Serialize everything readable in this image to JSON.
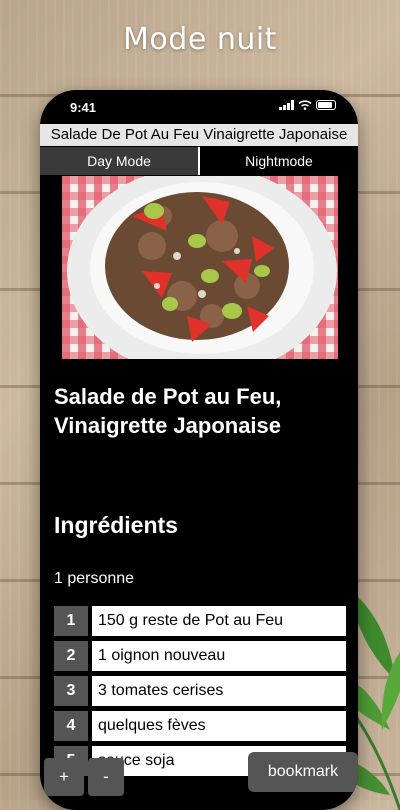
{
  "promo": {
    "title": "Mode nuit"
  },
  "status": {
    "time": "9:41"
  },
  "app": {
    "title": "Salade De Pot Au Feu Vinaigrette Japonaise"
  },
  "tabs": [
    {
      "label": "Day Mode",
      "active": false
    },
    {
      "label": "Nightmode",
      "active": true
    }
  ],
  "recipe": {
    "title": "Salade de Pot au Feu, Vinaigrette Japonaise",
    "section": "Ingrédients",
    "servings": "1 personne",
    "ingredients": [
      {
        "num": "1",
        "text": "150 g reste de Pot au Feu"
      },
      {
        "num": "2",
        "text": "1 oignon nouveau"
      },
      {
        "num": "3",
        "text": "3 tomates cerises"
      },
      {
        "num": "4",
        "text": "quelques fèves"
      },
      {
        "num": "5",
        "text": "sauce soja"
      }
    ]
  },
  "controls": {
    "plus": "+",
    "minus": "-",
    "bookmark": "bookmark"
  },
  "colors": {
    "background": "#000000",
    "tab_inactive": "#3a3a3a",
    "number_badge": "#555555"
  }
}
